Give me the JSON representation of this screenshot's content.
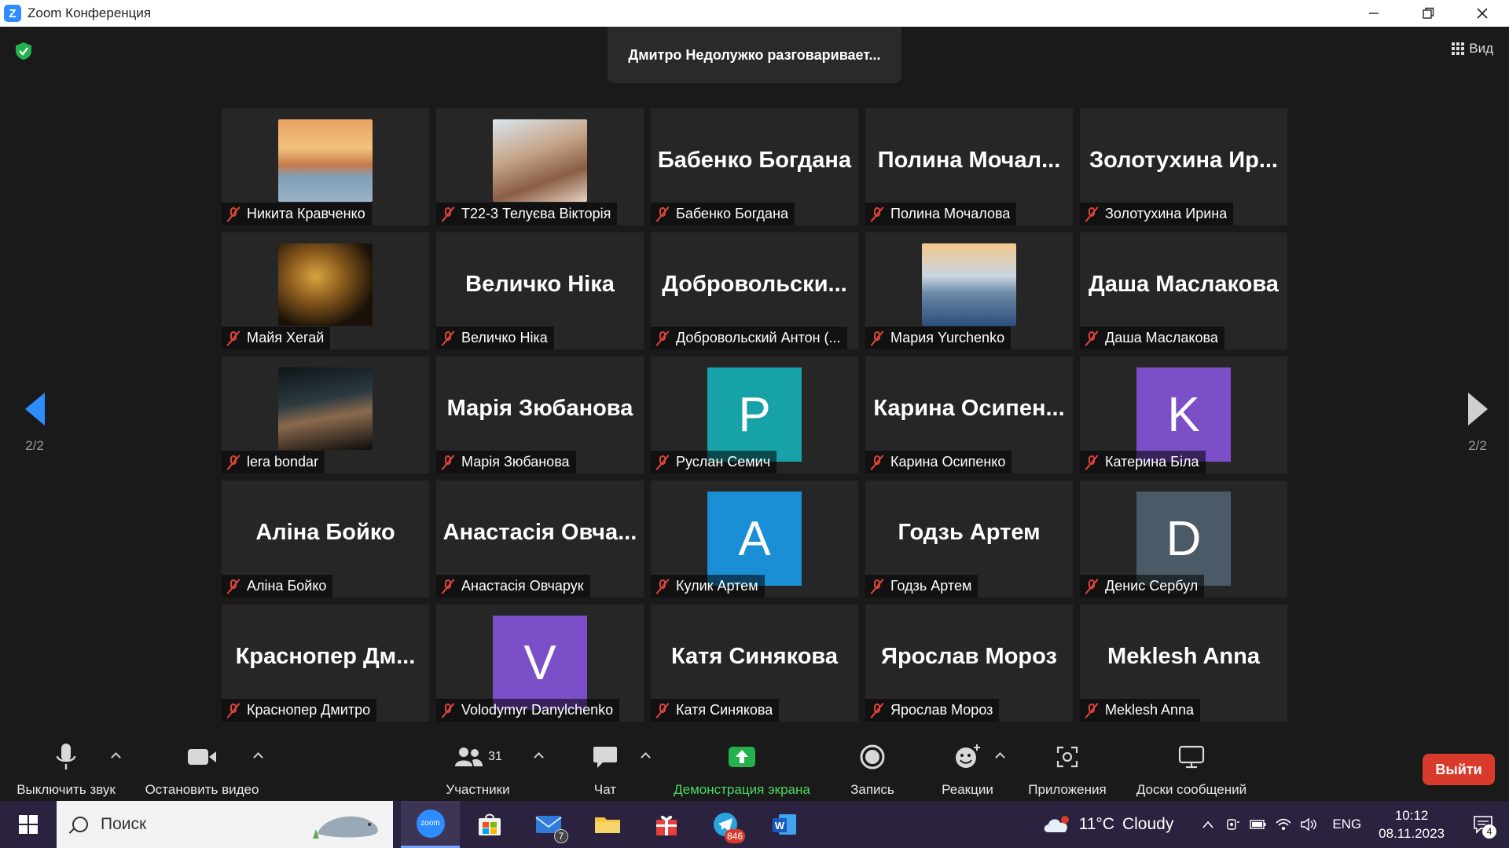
{
  "window": {
    "title": "Zoom Конференция",
    "logo_letter": "Z"
  },
  "speaking_banner": "Дмитро Недолужко разговаривает...",
  "view_button": "Вид",
  "pager": {
    "left_label": "2/2",
    "right_label": "2/2"
  },
  "participants": [
    {
      "display_name": "Никита Кравченко",
      "tile": "photo",
      "photo": "sunset"
    },
    {
      "display_name": "Т22-3 Телуєва Вікторія",
      "tile": "photo",
      "photo": "girl-outdoor"
    },
    {
      "display_name": "Бабенко Богдана",
      "tile": "name",
      "big_name": "Бабенко Богдана"
    },
    {
      "display_name": "Полина Мочалова",
      "tile": "name",
      "big_name": "Полина  Мочал..."
    },
    {
      "display_name": "Золотухина Ирина",
      "tile": "name",
      "big_name": "Золотухина  Ир..."
    },
    {
      "display_name": "Майя Хегай",
      "tile": "photo",
      "photo": "night-city"
    },
    {
      "display_name": "Величко  Ніка",
      "tile": "name",
      "big_name": "Величко  Ніка"
    },
    {
      "display_name": "Добровольский Антон (...",
      "tile": "name",
      "big_name": "Добровольски..."
    },
    {
      "display_name": "Мария Yurchenko",
      "tile": "photo",
      "photo": "sea-sunset"
    },
    {
      "display_name": "Даша Маслакова",
      "tile": "name",
      "big_name": "Даша Маслакова"
    },
    {
      "display_name": "lera bondar",
      "tile": "photo",
      "photo": "dark-room"
    },
    {
      "display_name": "Марія Зюбанова",
      "tile": "name",
      "big_name": "Марія Зюбанова"
    },
    {
      "display_name": "Руслан Семич",
      "tile": "avatar",
      "letter": "P",
      "color": "#17a2a8"
    },
    {
      "display_name": "Карина Осипенко",
      "tile": "name",
      "big_name": "Карина  Осипен..."
    },
    {
      "display_name": "Катерина Біла",
      "tile": "avatar",
      "letter": "K",
      "color": "#7b4fc7"
    },
    {
      "display_name": "Аліна Бойко",
      "tile": "name",
      "big_name": "Аліна Бойко"
    },
    {
      "display_name": "Анастасія Овчарук",
      "tile": "name",
      "big_name": "Анастасія  Овча..."
    },
    {
      "display_name": "Кулик Артем",
      "tile": "avatar",
      "letter": "A",
      "color": "#1a8fd6"
    },
    {
      "display_name": "Годзь Артем",
      "tile": "name",
      "big_name": "Годзь Артем"
    },
    {
      "display_name": "Денис Сербул",
      "tile": "avatar",
      "letter": "D",
      "color": "#4a5a66"
    },
    {
      "display_name": "Краснопер Дмитро",
      "tile": "name",
      "big_name": "Краснопер  Дм..."
    },
    {
      "display_name": "Volodymyr Danylchenko",
      "tile": "avatar",
      "letter": "V",
      "color": "#7b4fc7"
    },
    {
      "display_name": "Катя Синякова",
      "tile": "name",
      "big_name": "Катя Синякова"
    },
    {
      "display_name": "Ярослав Мороз",
      "tile": "name",
      "big_name": "Ярослав Мороз"
    },
    {
      "display_name": "Meklesh Anna",
      "tile": "name",
      "big_name": "Meklesh Anna"
    }
  ],
  "toolbar": {
    "mute_label": "Выключить звук",
    "video_label": "Остановить видео",
    "participants_label": "Участники",
    "participants_count": "31",
    "chat_label": "Чат",
    "share_label": "Демонстрация экрана",
    "record_label": "Запись",
    "reactions_label": "Реакции",
    "apps_label": "Приложения",
    "whiteboards_label": "Доски сообщений",
    "leave_label": "Выйти"
  },
  "taskbar": {
    "search_placeholder": "Поиск",
    "zoom_app_text": "zoom",
    "mail_badge": "7",
    "telegram_badge": "846",
    "weather_temp": "11°C",
    "weather_text": "Cloudy",
    "language": "ENG",
    "time": "10:12",
    "date": "08.11.2023",
    "notifications_count": "4"
  },
  "colors": {
    "accent": "#2d8cff",
    "leave": "#d83b2b",
    "share_green": "#4cd964",
    "muted_red": "#e0443a"
  }
}
